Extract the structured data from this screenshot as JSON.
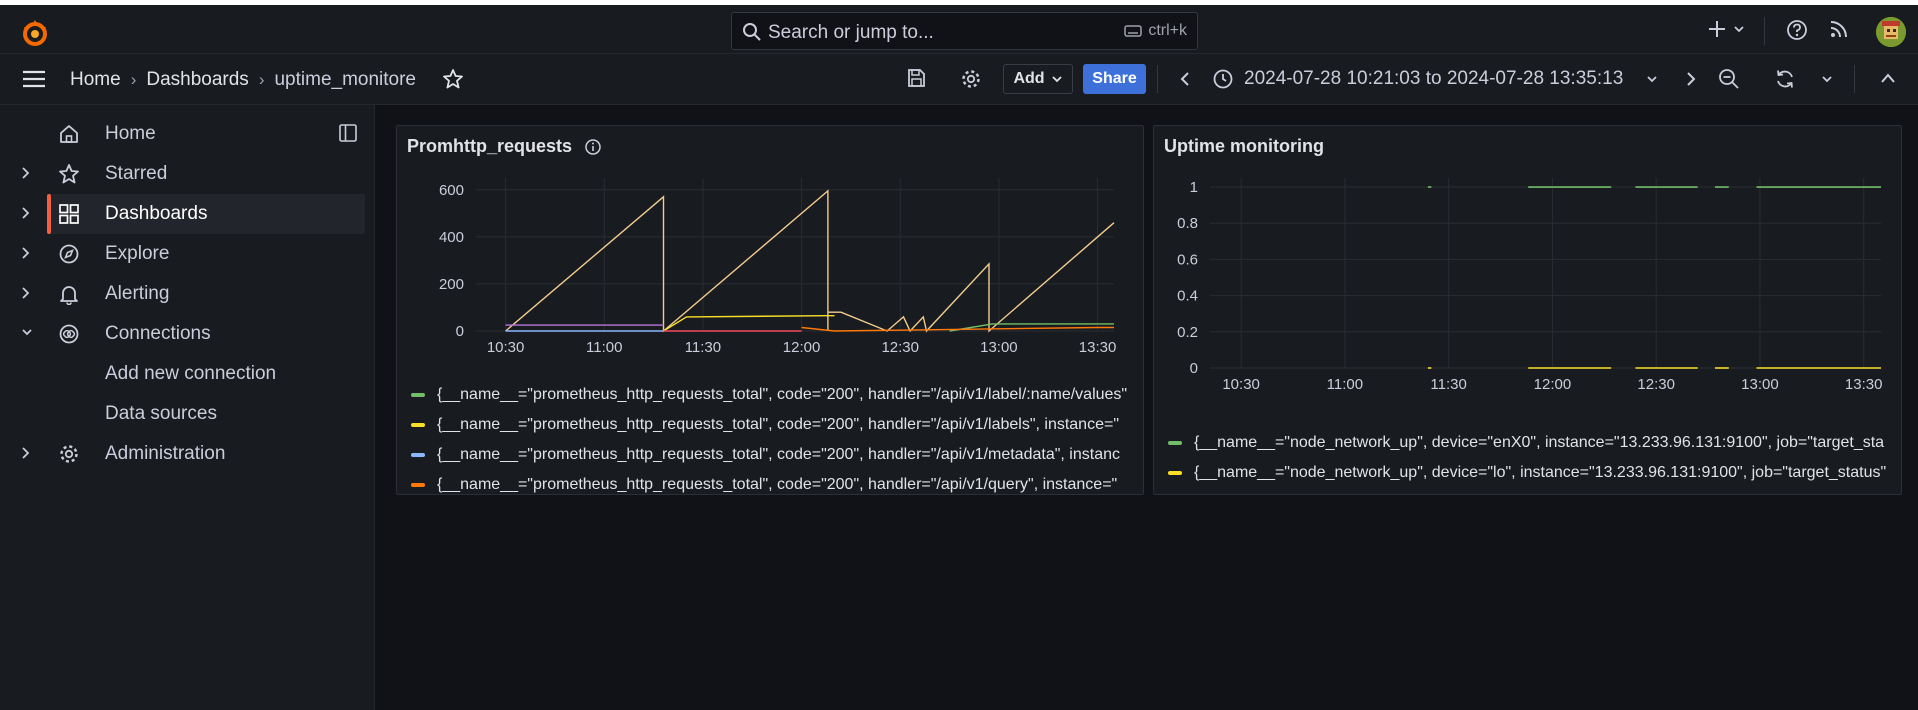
{
  "topbar": {
    "search_placeholder": "Search or jump to...",
    "search_shortcut": "ctrl+k"
  },
  "breadcrumb": {
    "home": "Home",
    "dashboards": "Dashboards",
    "current": "uptime_monitore"
  },
  "toolbar": {
    "add_label": "Add",
    "share_label": "Share",
    "time_range": "2024-07-28 10:21:03 to 2024-07-28 13:35:13"
  },
  "sidebar": {
    "items": [
      {
        "label": "Home",
        "icon": "home-icon"
      },
      {
        "label": "Starred",
        "icon": "star-icon"
      },
      {
        "label": "Dashboards",
        "icon": "grid-icon"
      },
      {
        "label": "Explore",
        "icon": "compass-icon"
      },
      {
        "label": "Alerting",
        "icon": "bell-icon"
      },
      {
        "label": "Connections",
        "icon": "link-icon"
      },
      {
        "label": "Add new connection"
      },
      {
        "label": "Data sources"
      },
      {
        "label": "Administration",
        "icon": "gear-icon"
      }
    ]
  },
  "colors": {
    "accent": "#f55f3e",
    "share": "#3d71d9",
    "green": "#73bf69",
    "yellow": "#fade2a",
    "blue": "#8ab8ff",
    "orange": "#ff780a",
    "red": "#f2495c",
    "purple": "#b877d9",
    "light_yellow": "#f2cc8f"
  },
  "panels": [
    {
      "title": "Promhttp_requests",
      "legend": [
        "{__name__=\"prometheus_http_requests_total\", code=\"200\", handler=\"/api/v1/label/:name/values\"",
        "{__name__=\"prometheus_http_requests_total\", code=\"200\", handler=\"/api/v1/labels\", instance=\"",
        "{__name__=\"prometheus_http_requests_total\", code=\"200\", handler=\"/api/v1/metadata\", instanc",
        "{__name__=\"prometheus_http_requests_total\", code=\"200\", handler=\"/api/v1/query\", instance=\""
      ]
    },
    {
      "title": "Uptime monitoring",
      "legend": [
        "{__name__=\"node_network_up\", device=\"enX0\", instance=\"13.233.96.131:9100\", job=\"target_sta",
        "{__name__=\"node_network_up\", device=\"lo\", instance=\"13.233.96.131:9100\", job=\"target_status\""
      ]
    }
  ],
  "chart_data": [
    {
      "type": "line",
      "title": "Promhttp_requests",
      "x_ticks": [
        "10:30",
        "11:00",
        "11:30",
        "12:00",
        "12:30",
        "13:00",
        "13:30"
      ],
      "y_ticks": [
        0,
        200,
        400,
        600
      ],
      "ylim": [
        0,
        650
      ],
      "xlim": [
        "10:21",
        "13:35"
      ],
      "series": [
        {
          "color": "#f2cc8f",
          "points": [
            [
              "10:30",
              0
            ],
            [
              "11:18",
              570
            ],
            [
              "11:18",
              0
            ],
            [
              "12:08",
              595
            ],
            [
              "12:08",
              0
            ],
            [
              "12:08",
              80
            ],
            [
              "12:12",
              80
            ],
            [
              "12:26",
              0
            ],
            [
              "12:31",
              60
            ],
            [
              "12:33",
              0
            ],
            [
              "12:37",
              60
            ],
            [
              "12:38",
              0
            ],
            [
              "12:57",
              285
            ],
            [
              "12:57",
              0
            ],
            [
              "13:35",
              460
            ]
          ]
        },
        {
          "color": "#fade2a",
          "points": [
            [
              "11:18",
              0
            ],
            [
              "11:25",
              60
            ],
            [
              "12:08",
              65
            ],
            [
              "12:10",
              65
            ]
          ]
        },
        {
          "color": "#73bf69",
          "points": [
            [
              "12:45",
              0
            ],
            [
              "12:58",
              30
            ],
            [
              "13:35",
              30
            ]
          ]
        },
        {
          "color": "#b877d9",
          "points": [
            [
              "10:30",
              25
            ],
            [
              "11:18",
              25
            ]
          ]
        },
        {
          "color": "#8ab8ff",
          "points": [
            [
              "10:30",
              0
            ],
            [
              "11:18",
              0
            ]
          ]
        },
        {
          "color": "#f2495c",
          "points": [
            [
              "11:18",
              0
            ],
            [
              "12:00",
              0
            ]
          ]
        },
        {
          "color": "#ff780a",
          "points": [
            [
              "12:00",
              15
            ],
            [
              "12:10",
              0
            ],
            [
              "13:30",
              15
            ],
            [
              "13:35",
              15
            ]
          ]
        }
      ]
    },
    {
      "type": "line",
      "title": "Uptime monitoring",
      "x_ticks": [
        "10:30",
        "11:00",
        "11:30",
        "12:00",
        "12:30",
        "13:00",
        "13:30"
      ],
      "y_ticks": [
        0,
        0.2,
        0.4,
        0.6,
        0.8,
        1
      ],
      "ylim": [
        0,
        1.05
      ],
      "xlim": [
        "10:21",
        "13:35"
      ],
      "series": [
        {
          "color": "#73bf69",
          "segments": [
            [
              "11:24",
              "11:25",
              1
            ],
            [
              "11:53",
              "12:00",
              1
            ],
            [
              "12:00",
              "12:17",
              1
            ],
            [
              "12:24",
              "12:42",
              1
            ],
            [
              "12:47",
              "12:51",
              1
            ],
            [
              "12:59",
              "13:37",
              1
            ]
          ]
        },
        {
          "color": "#fade2a",
          "segments": [
            [
              "11:24",
              "11:25",
              0
            ],
            [
              "11:53",
              "12:00",
              0
            ],
            [
              "12:00",
              "12:17",
              0
            ],
            [
              "12:24",
              "12:42",
              0
            ],
            [
              "12:47",
              "12:51",
              0
            ],
            [
              "12:59",
              "13:37",
              0
            ]
          ]
        }
      ]
    }
  ]
}
